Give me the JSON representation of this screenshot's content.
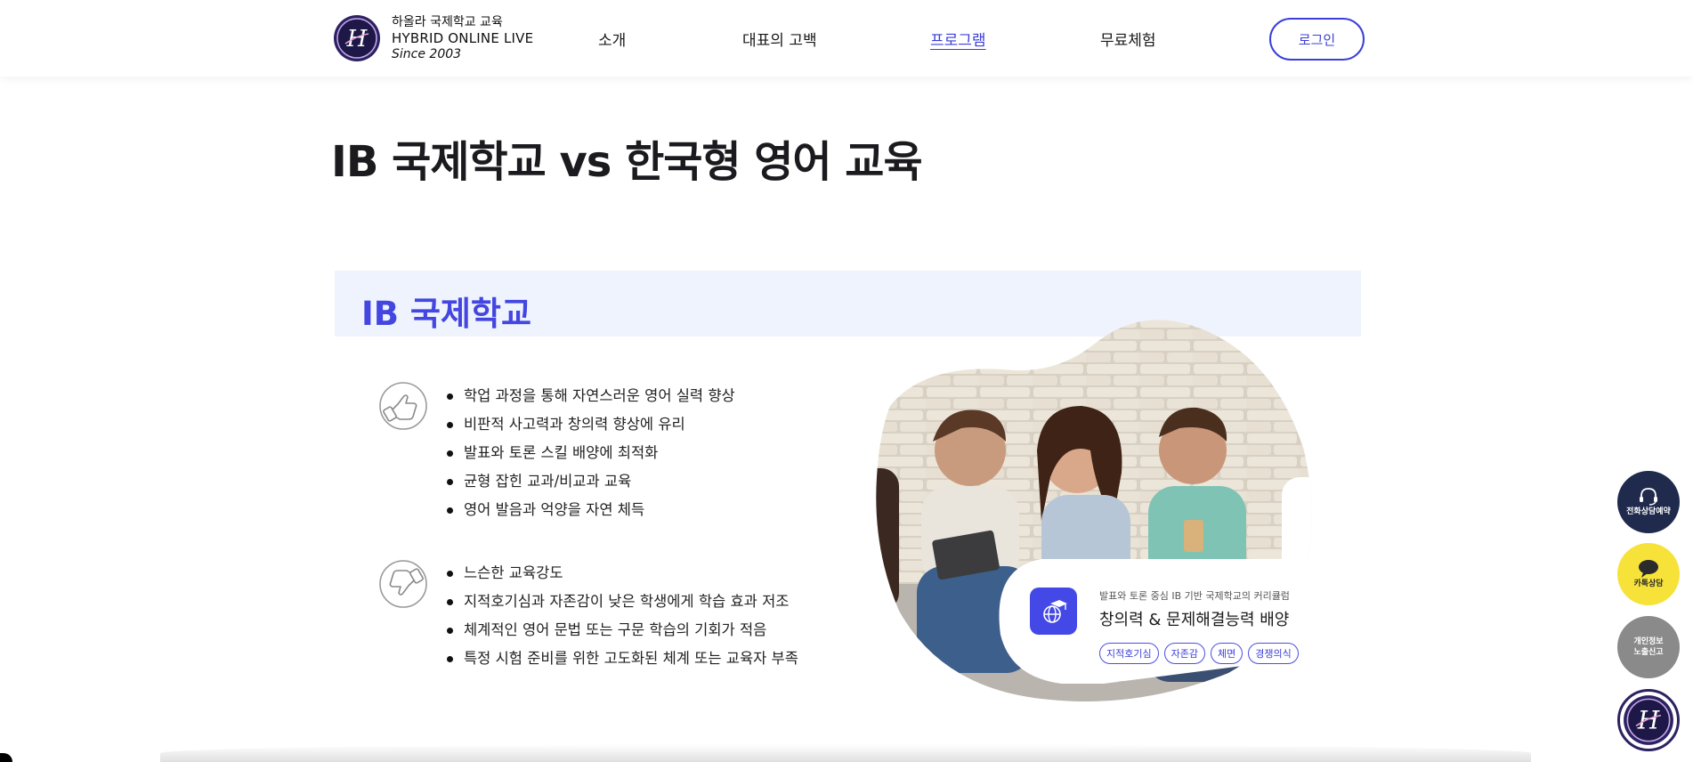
{
  "header": {
    "brand_line1": "하올라 국제학교 교육",
    "brand_line2": "HYBRID ONLINE LIVE",
    "brand_line3": "Since 2003",
    "nav": [
      {
        "label": "소개"
      },
      {
        "label": "대표의 고백"
      },
      {
        "label": "프로그램"
      },
      {
        "label": "무료체험"
      }
    ],
    "login_label": "로그인"
  },
  "page_title": "IB 국제학교 vs 한국형 영어 교육",
  "section": {
    "title": "IB 국제학교",
    "pros": [
      "학업 과정을 통해 자연스러운 영어 실력 향상",
      "비판적 사고력과 창의력 향상에 유리",
      "발표와 토론 스킬 배양에 최적화",
      "균형 잡힌 교과/비교과 교육",
      "영어 발음과 억양을 자연 체득"
    ],
    "cons": [
      "느슨한 교육강도",
      "지적호기심과 자존감이 낮은 학생에게 학습 효과 저조",
      "체계적인 영어 문법 또는 구문 학습의 기회가 적음",
      "특정 시험 준비를 위한 고도화된 체계 또는 교육자 부족"
    ],
    "card": {
      "subtitle": "발표와 토론 중심 IB 기반 국제학교의 커리큘럼",
      "title": "창의력 & 문제해결능력 배양",
      "tags": [
        "지적호기심",
        "자존감",
        "체면",
        "경쟁의식"
      ]
    }
  },
  "side_buttons": {
    "call": "전화상담예약",
    "kakao": "카톡상담",
    "privacy_line1": "개인정보",
    "privacy_line2": "노출신고"
  },
  "colors": {
    "accent": "#3b3fd8",
    "banner_bg": "#eff3fd",
    "kakao": "#f7e23a",
    "navy": "#1f2a4d"
  }
}
